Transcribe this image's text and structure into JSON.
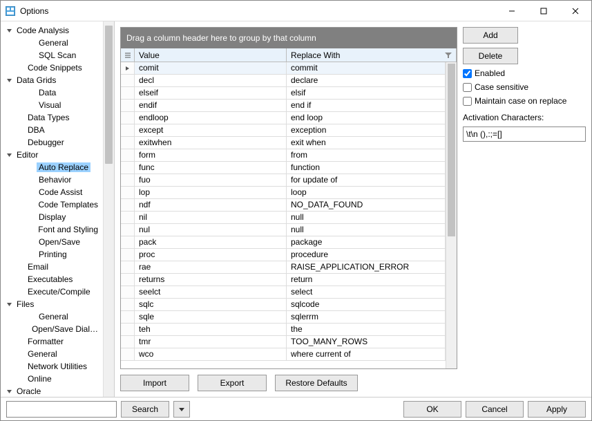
{
  "window": {
    "title": "Options"
  },
  "titlebar_btns": {
    "min": "−",
    "max": "□",
    "close": "✕"
  },
  "tree": [
    {
      "indent": 0,
      "exp": "v",
      "label": "Code Analysis"
    },
    {
      "indent": 2,
      "exp": "",
      "label": "General"
    },
    {
      "indent": 2,
      "exp": "",
      "label": "SQL Scan"
    },
    {
      "indent": 1,
      "exp": "",
      "label": "Code Snippets"
    },
    {
      "indent": 0,
      "exp": "v",
      "label": "Data Grids"
    },
    {
      "indent": 2,
      "exp": "",
      "label": "Data"
    },
    {
      "indent": 2,
      "exp": "",
      "label": "Visual"
    },
    {
      "indent": 1,
      "exp": "",
      "label": "Data Types"
    },
    {
      "indent": 1,
      "exp": "",
      "label": "DBA"
    },
    {
      "indent": 1,
      "exp": "",
      "label": "Debugger"
    },
    {
      "indent": 0,
      "exp": "v",
      "label": "Editor"
    },
    {
      "indent": 2,
      "exp": "",
      "label": "Auto Replace",
      "selected": true
    },
    {
      "indent": 2,
      "exp": "",
      "label": "Behavior"
    },
    {
      "indent": 2,
      "exp": "",
      "label": "Code Assist"
    },
    {
      "indent": 2,
      "exp": "",
      "label": "Code Templates"
    },
    {
      "indent": 2,
      "exp": "",
      "label": "Display"
    },
    {
      "indent": 2,
      "exp": "",
      "label": "Font and Styling"
    },
    {
      "indent": 2,
      "exp": "",
      "label": "Open/Save"
    },
    {
      "indent": 2,
      "exp": "",
      "label": "Printing"
    },
    {
      "indent": 1,
      "exp": "",
      "label": "Email"
    },
    {
      "indent": 1,
      "exp": "",
      "label": "Executables"
    },
    {
      "indent": 1,
      "exp": "",
      "label": "Execute/Compile"
    },
    {
      "indent": 0,
      "exp": "v",
      "label": "Files"
    },
    {
      "indent": 2,
      "exp": "",
      "label": "General"
    },
    {
      "indent": 2,
      "exp": "",
      "label": "Open/Save Dial…"
    },
    {
      "indent": 1,
      "exp": "",
      "label": "Formatter"
    },
    {
      "indent": 1,
      "exp": "",
      "label": "General"
    },
    {
      "indent": 1,
      "exp": "",
      "label": "Network Utilities"
    },
    {
      "indent": 1,
      "exp": "",
      "label": "Online"
    },
    {
      "indent": 0,
      "exp": "v",
      "label": "Oracle"
    }
  ],
  "grid": {
    "groupbar": "Drag a column header here to group by that column",
    "col_value": "Value",
    "col_replace": "Replace With",
    "rows": [
      {
        "v": "comit",
        "r": "commit",
        "sel": true,
        "arrow": true
      },
      {
        "v": "decl",
        "r": "declare"
      },
      {
        "v": "elseif",
        "r": "elsif"
      },
      {
        "v": "endif",
        "r": "end if"
      },
      {
        "v": "endloop",
        "r": "end loop"
      },
      {
        "v": "except",
        "r": "exception"
      },
      {
        "v": "exitwhen",
        "r": "exit when"
      },
      {
        "v": "form",
        "r": "from"
      },
      {
        "v": "func",
        "r": "function"
      },
      {
        "v": "fuo",
        "r": "for update of"
      },
      {
        "v": "lop",
        "r": "loop"
      },
      {
        "v": "ndf",
        "r": "NO_DATA_FOUND"
      },
      {
        "v": "nil",
        "r": "null"
      },
      {
        "v": "nul",
        "r": "null"
      },
      {
        "v": "pack",
        "r": "package"
      },
      {
        "v": "proc",
        "r": "procedure"
      },
      {
        "v": "rae",
        "r": "RAISE_APPLICATION_ERROR"
      },
      {
        "v": "returns",
        "r": "return"
      },
      {
        "v": "seelct",
        "r": "select"
      },
      {
        "v": "sqlc",
        "r": "sqlcode"
      },
      {
        "v": "sqle",
        "r": "sqlerrm"
      },
      {
        "v": "teh",
        "r": "the"
      },
      {
        "v": "tmr",
        "r": "TOO_MANY_ROWS"
      },
      {
        "v": "wco",
        "r": "where current of"
      }
    ]
  },
  "controls": {
    "add": "Add",
    "delete": "Delete",
    "enabled": "Enabled",
    "enabled_checked": true,
    "case_sensitive": "Case sensitive",
    "case_sensitive_checked": false,
    "maintain_case": "Maintain case on replace",
    "maintain_case_checked": false,
    "activation_label": "Activation Characters:",
    "activation_value": "\\t\\n (),:;=[]"
  },
  "rowbtns": {
    "import": "Import",
    "export": "Export",
    "restore": "Restore Defaults"
  },
  "footer": {
    "search": "Search",
    "ok": "OK",
    "cancel": "Cancel",
    "apply": "Apply"
  }
}
